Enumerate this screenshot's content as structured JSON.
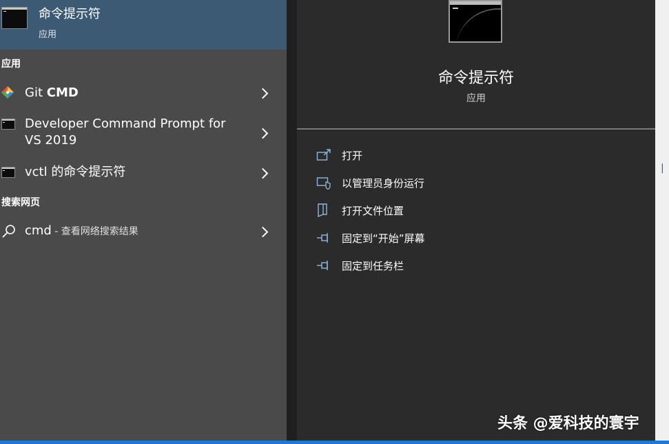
{
  "best_match": {
    "title": "命令提示符",
    "subtitle": "应用"
  },
  "sections": {
    "apps": "应用",
    "web": "搜索网页"
  },
  "apps": [
    {
      "label_normal": "Git ",
      "label_bold": "CMD",
      "icon": "git-icon"
    },
    {
      "label_line1": "Developer Command Prompt for",
      "label_line2": "VS 2019",
      "icon": "cmd-icon"
    },
    {
      "label": "vctl 的命令提示符",
      "icon": "cmd-icon"
    }
  ],
  "web_search": {
    "term": "cmd",
    "suffix": " - 查看网络搜索结果",
    "icon": "search-icon"
  },
  "detail": {
    "title": "命令提示符",
    "subtitle": "应用",
    "actions": [
      {
        "label": "打开",
        "icon": "open-icon"
      },
      {
        "label": "以管理员身份运行",
        "icon": "admin-shield-icon"
      },
      {
        "label": "打开文件位置",
        "icon": "file-location-icon"
      },
      {
        "label": "固定到“开始”屏幕",
        "icon": "pin-icon"
      },
      {
        "label": "固定到任务栏",
        "icon": "pin-icon"
      }
    ]
  },
  "watermark": "头条 @爱科技的寰宇",
  "colors": {
    "selected_bg": "#3d5a75",
    "left_bg": "#4a4a4a",
    "right_bg": "#2b2b2b",
    "icon_accent": "#8fb8e0",
    "taskbar": "#1e78d7"
  }
}
